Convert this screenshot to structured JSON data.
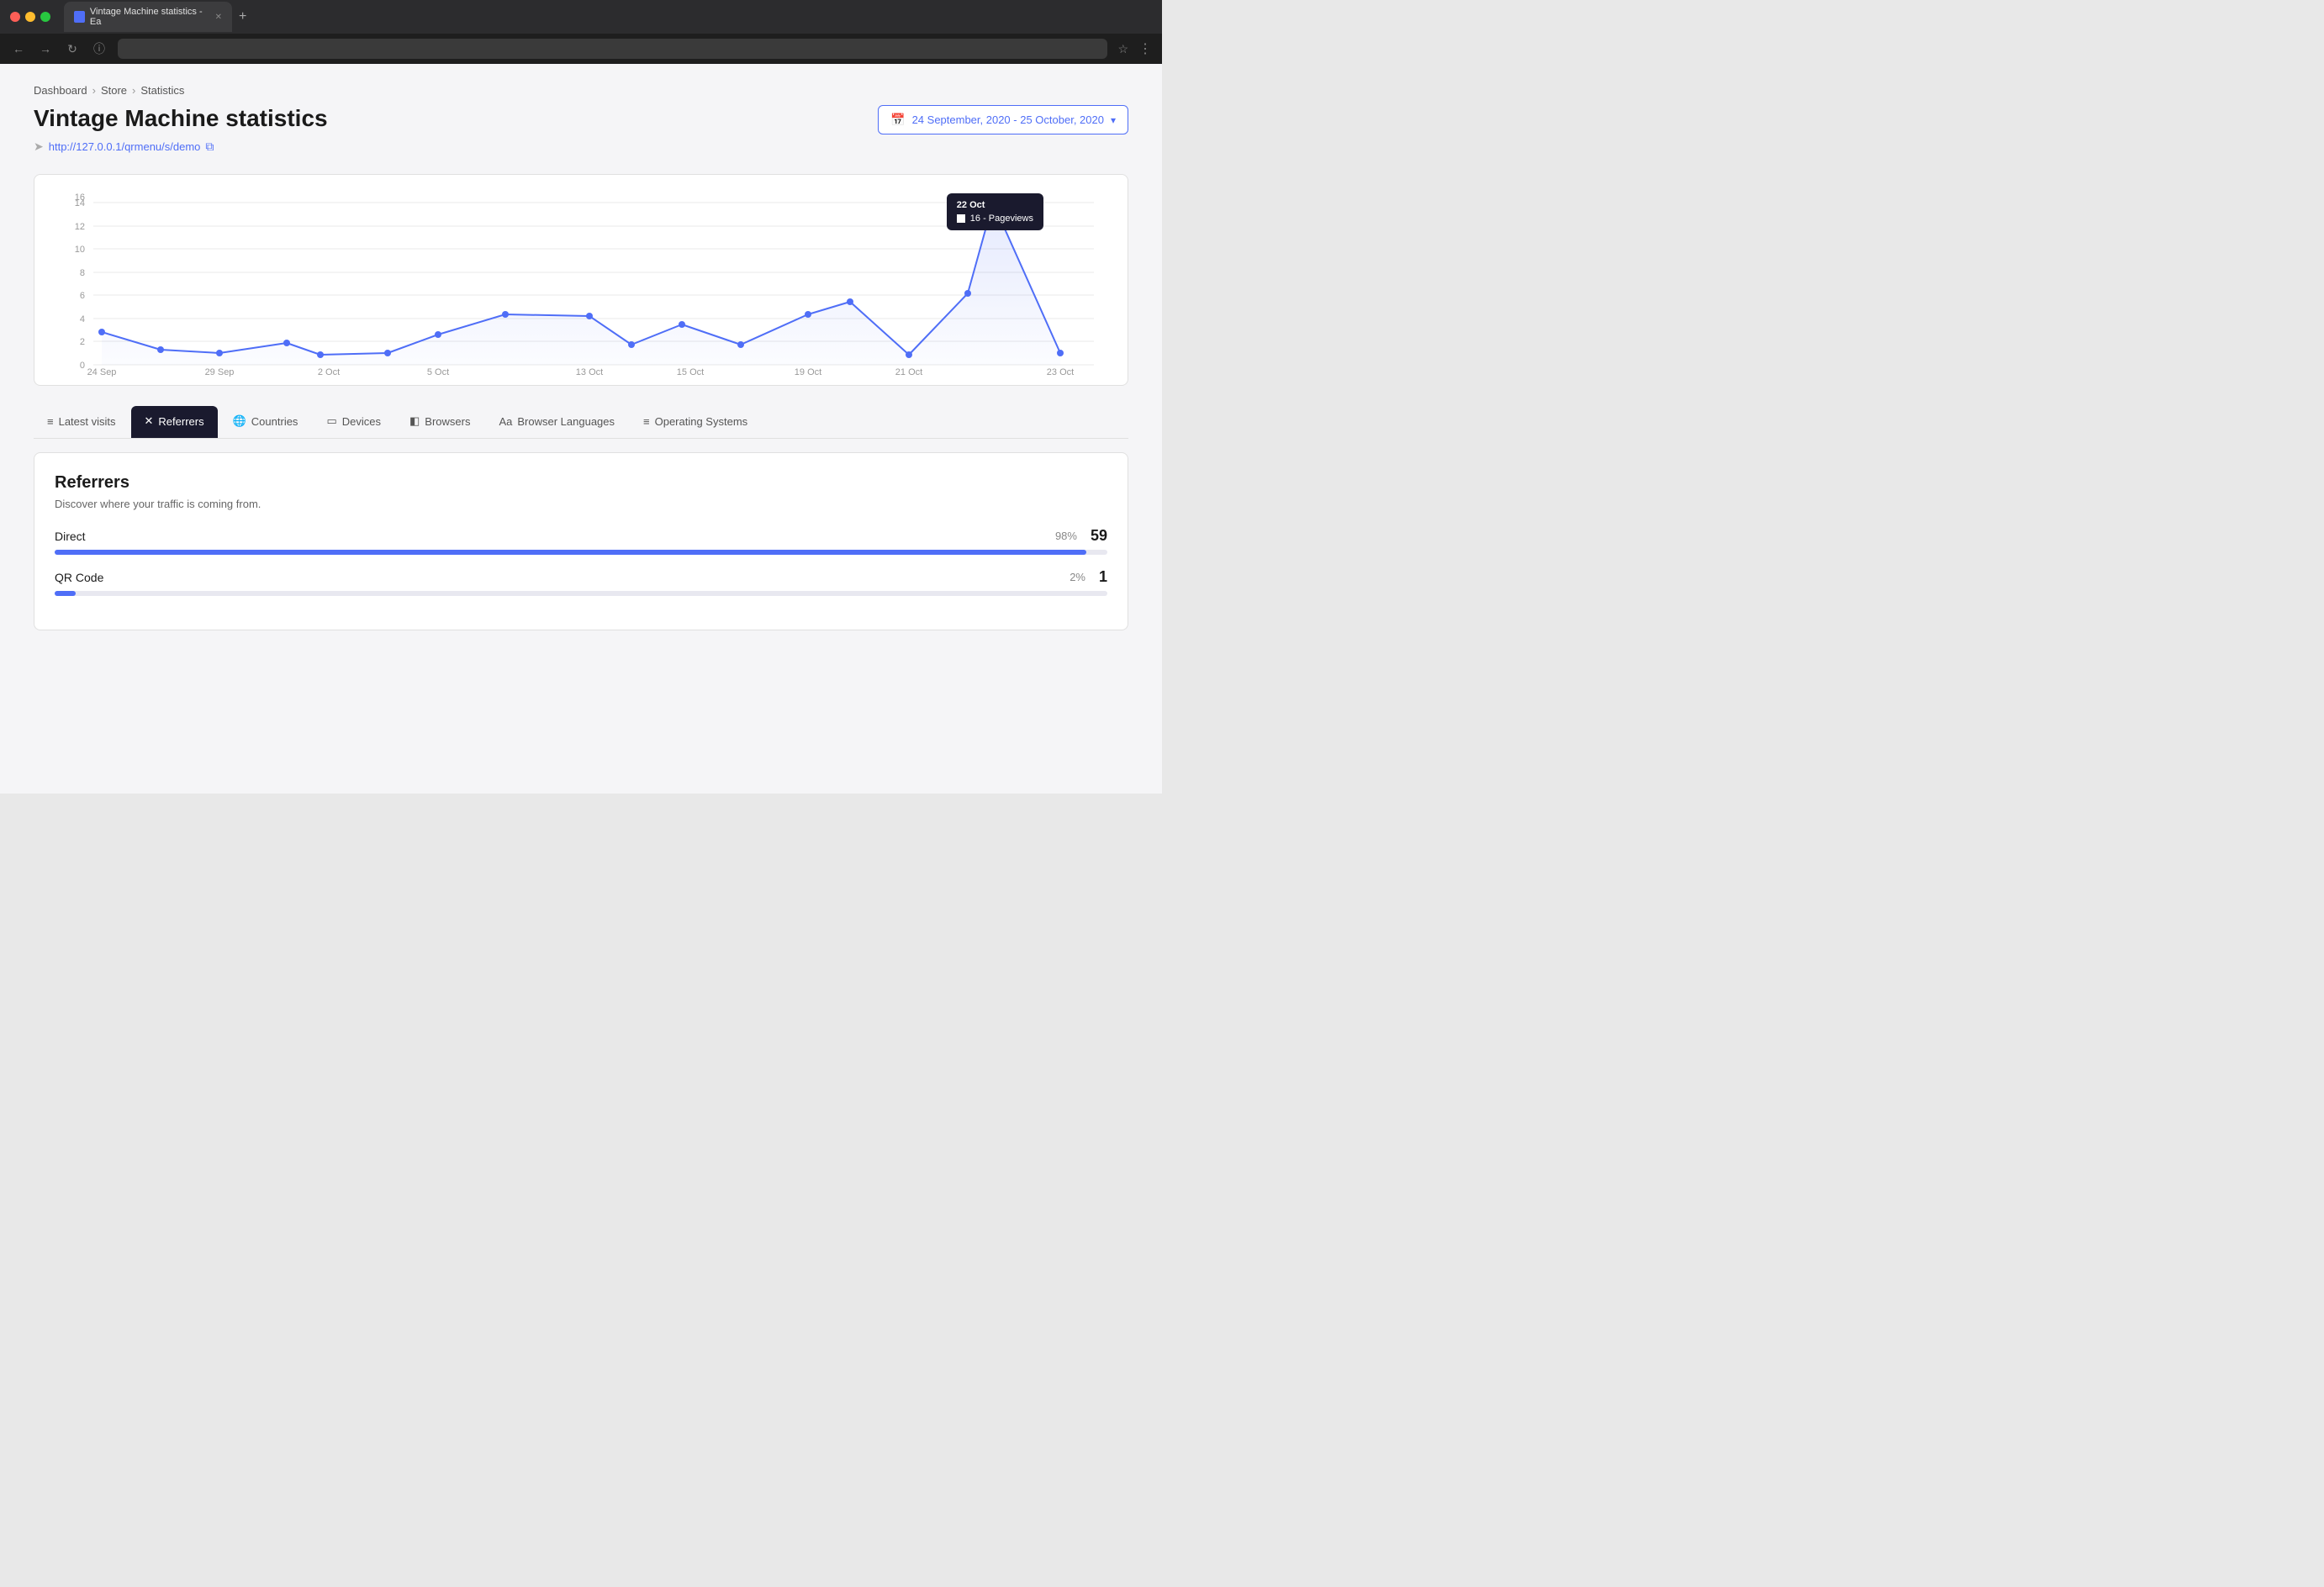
{
  "browser": {
    "tab_title": "Vintage Machine statistics - Ea",
    "address": "",
    "new_tab_label": "+"
  },
  "breadcrumb": {
    "items": [
      "Dashboard",
      "Store",
      "Statistics"
    ],
    "separators": [
      ">",
      ">"
    ]
  },
  "header": {
    "title": "Vintage Machine statistics",
    "url": "http://127.0.0.1/qrmenu/s/demo",
    "date_range": "24 September, 2020 - 25 October, 2020",
    "date_range_chevron": "▾"
  },
  "chart": {
    "y_labels": [
      "0",
      "2",
      "4",
      "6",
      "8",
      "10",
      "12",
      "14",
      "16"
    ],
    "x_labels": [
      "24 Sep",
      "29 Sep",
      "2 Oct",
      "5 Oct",
      "13 Oct",
      "15 Oct",
      "19 Oct",
      "21 Oct",
      "23 Oct"
    ],
    "tooltip": {
      "date": "22 Oct",
      "value": "16 - Pageviews"
    }
  },
  "tabs": [
    {
      "id": "latest-visits",
      "label": "Latest visits",
      "icon": "≡"
    },
    {
      "id": "referrers",
      "label": "Referrers",
      "icon": "✕",
      "active": true
    },
    {
      "id": "countries",
      "label": "Countries",
      "icon": "🌐"
    },
    {
      "id": "devices",
      "label": "Devices",
      "icon": "⬜"
    },
    {
      "id": "browsers",
      "label": "Browsers",
      "icon": "⬛"
    },
    {
      "id": "browser-languages",
      "label": "Browser Languages",
      "icon": "Aa"
    },
    {
      "id": "operating-systems",
      "label": "Operating Systems",
      "icon": "≡"
    }
  ],
  "panel": {
    "title": "Referrers",
    "subtitle": "Discover where your traffic is coming from.",
    "rows": [
      {
        "name": "Direct",
        "pct": "98%",
        "count": "59",
        "fill_pct": 98
      },
      {
        "name": "QR Code",
        "pct": "2%",
        "count": "1",
        "fill_pct": 2
      }
    ]
  }
}
